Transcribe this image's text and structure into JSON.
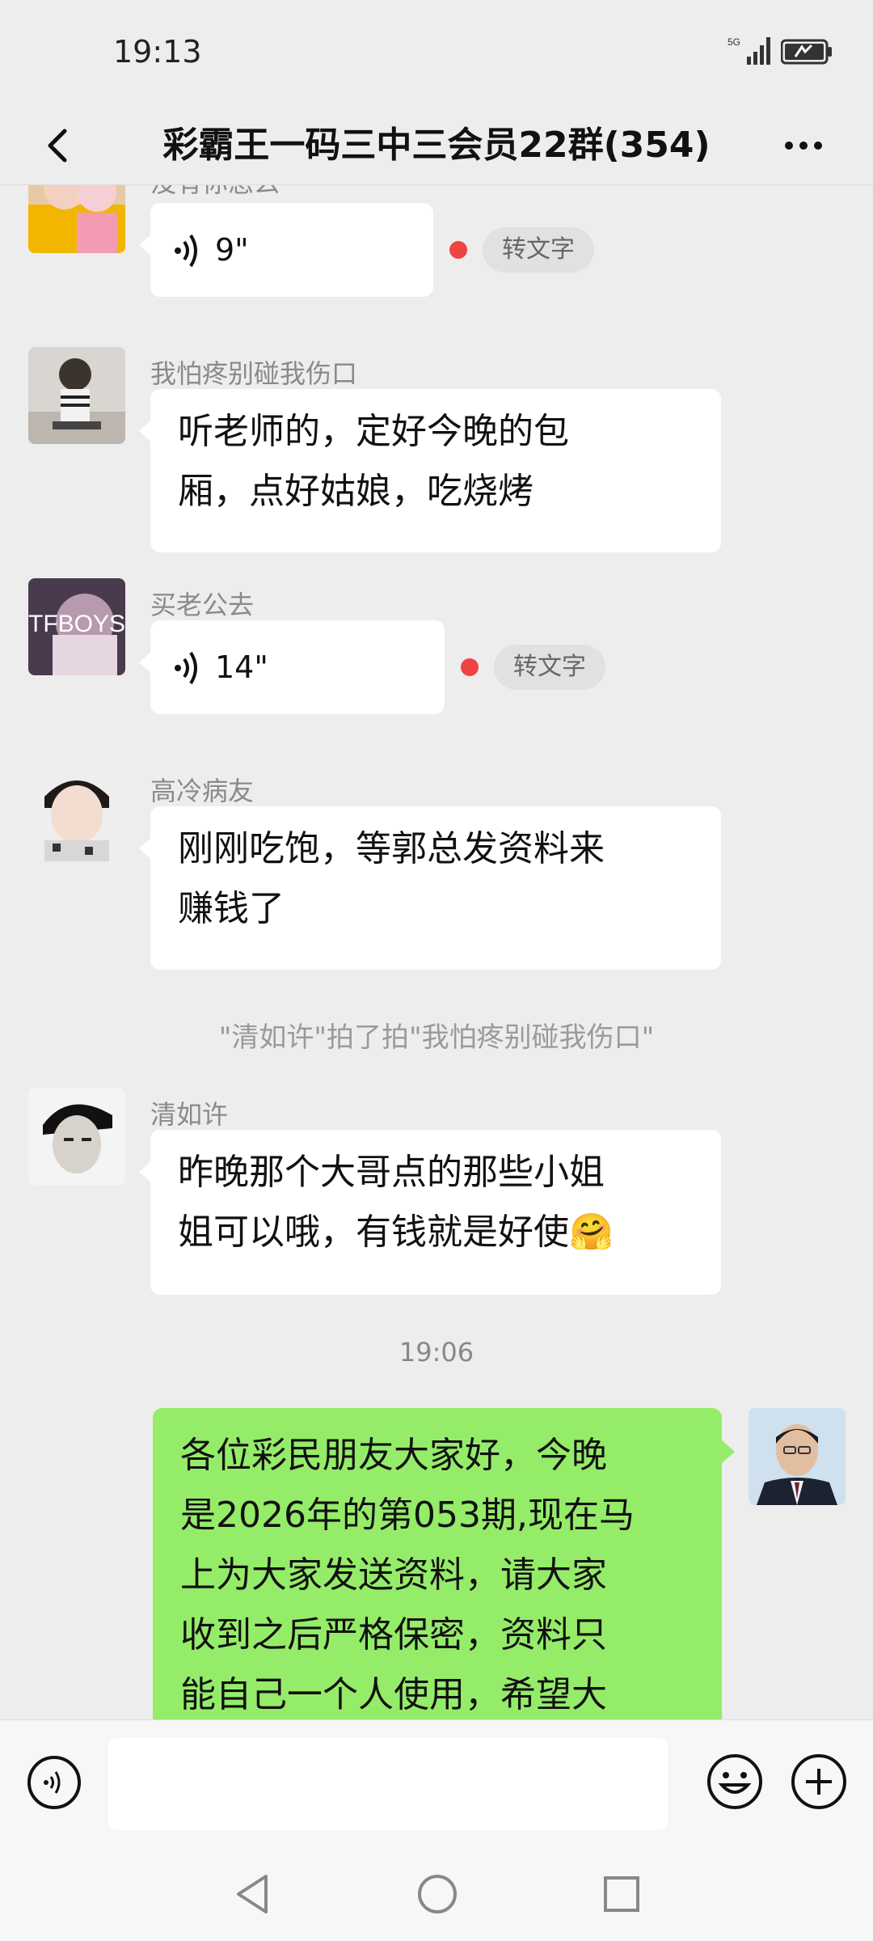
{
  "status_bar": {
    "time": "19:13",
    "network": "5G"
  },
  "header": {
    "title": "彩霸王一码三中三会员22群(354)"
  },
  "messages": [
    {
      "type": "voice",
      "sender": "没有你怎么",
      "duration": "9\"",
      "to_text_label": "转文字"
    },
    {
      "type": "text",
      "sender": "我怕疼别碰我伤口",
      "lines": [
        "听老师的，定好今晚的包",
        "厢，点好姑娘，吃烧烤"
      ]
    },
    {
      "type": "voice",
      "sender": "买老公去",
      "avatar_text": "TFBOYS",
      "duration": "14\"",
      "to_text_label": "转文字"
    },
    {
      "type": "text",
      "sender": "高冷病友",
      "lines": [
        "刚刚吃饱，等郭总发资料来",
        "赚钱了"
      ]
    },
    {
      "type": "system",
      "text": "\"清如许\"拍了拍\"我怕疼别碰我伤口\""
    },
    {
      "type": "text",
      "sender": "清如许",
      "lines": [
        "昨晚那个大哥点的那些小姐",
        "姐可以哦，有钱就是好使🤗"
      ]
    },
    {
      "type": "time",
      "text": "19:06"
    },
    {
      "type": "text_self",
      "lines": [
        "各位彩民朋友大家好，今晚",
        "是2026年的第053期,现在马",
        "上为大家发送资料，请大家",
        "收到之后严格保密，资料只",
        "能自己一个人使用，希望大"
      ]
    }
  ],
  "input": {
    "value": "",
    "placeholder": ""
  },
  "colors": {
    "background": "#ededed",
    "self_bubble": "#95ec69",
    "unread_dot": "#f04343"
  }
}
